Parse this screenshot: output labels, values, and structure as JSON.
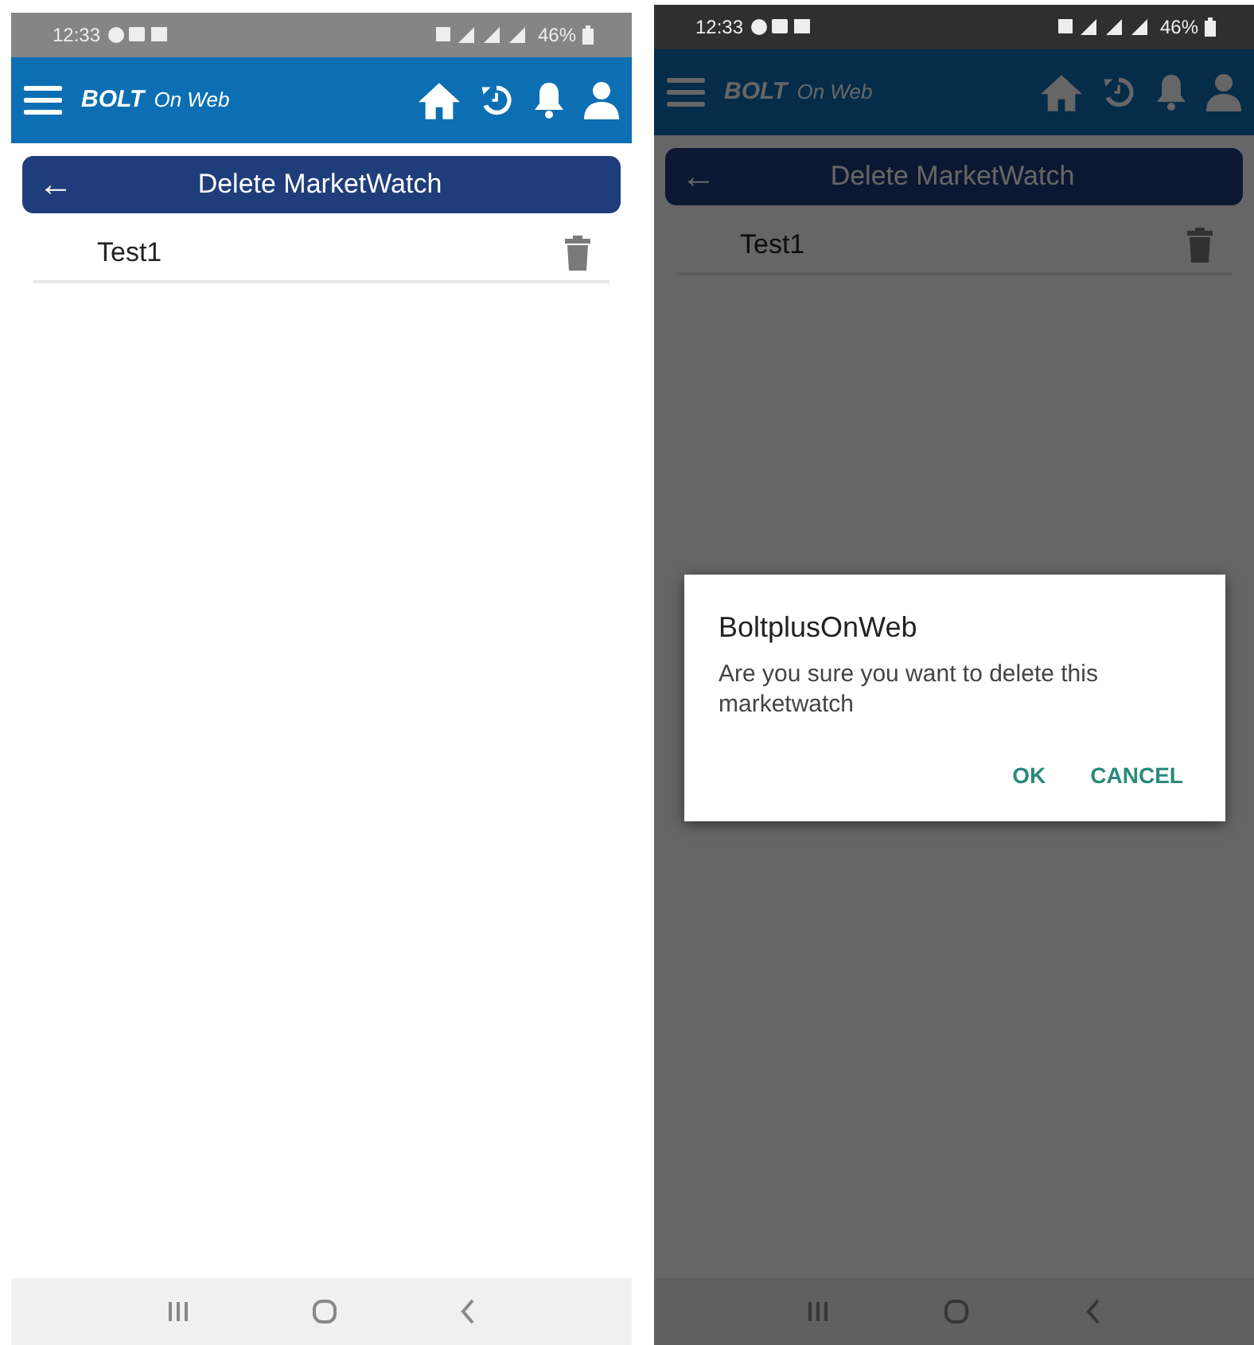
{
  "screens": [
    {
      "status_bar": {
        "time": "12:33",
        "battery": "46%"
      },
      "app_bar": {
        "logo_mark": "BOLT",
        "logo_text": "On Web"
      },
      "header": {
        "back": "←",
        "title": "Delete MarketWatch"
      },
      "items": [
        {
          "label": "Test1"
        }
      ]
    },
    {
      "status_bar": {
        "time": "12:33",
        "battery": "46%"
      },
      "app_bar": {
        "logo_mark": "BOLT",
        "logo_text": "On Web"
      },
      "header": {
        "back": "←",
        "title": "Delete MarketWatch"
      },
      "items": [
        {
          "label": "Test1"
        }
      ],
      "dialog": {
        "title": "BoltplusOnWeb",
        "message": "Are you sure you want to delete this marketwatch",
        "buttons": [
          "OK",
          "CANCEL"
        ]
      }
    }
  ]
}
